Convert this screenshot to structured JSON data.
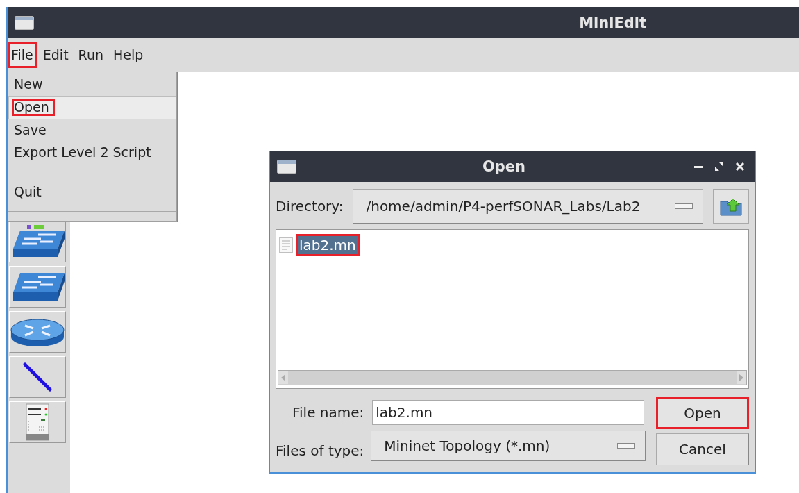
{
  "window": {
    "title": "MiniEdit"
  },
  "menubar": [
    {
      "label": "File",
      "selected": true,
      "highlighted": true
    },
    {
      "label": "Edit",
      "selected": false,
      "highlighted": false
    },
    {
      "label": "Run",
      "selected": false,
      "highlighted": false
    },
    {
      "label": "Help",
      "selected": false,
      "highlighted": false
    }
  ],
  "file_menu": [
    {
      "kind": "item",
      "label": "New",
      "selected": false,
      "highlighted": false
    },
    {
      "kind": "item",
      "label": "Open",
      "selected": true,
      "highlighted": true
    },
    {
      "kind": "item",
      "label": "Save",
      "selected": false,
      "highlighted": false
    },
    {
      "kind": "item",
      "label": "Export Level 2 Script",
      "selected": false,
      "highlighted": false
    },
    {
      "kind": "separator"
    },
    {
      "kind": "item",
      "label": "Quit",
      "selected": false,
      "highlighted": false
    },
    {
      "kind": "separator"
    }
  ],
  "toolbar": [
    {
      "kind": "switch"
    },
    {
      "kind": "legacy-switch"
    },
    {
      "kind": "router"
    },
    {
      "kind": "link"
    },
    {
      "kind": "controller"
    }
  ],
  "dialog": {
    "title": "Open",
    "directory_label": "Directory:",
    "directory": "/home/admin/P4-perfSONAR_Labs/Lab2",
    "files": [
      {
        "name": "lab2.mn",
        "selected": true,
        "highlighted": true
      }
    ],
    "file_name_label": "File name:",
    "file_name": "lab2.mn",
    "file_type_label": "Files of type:",
    "file_type": "Mininet Topology (*.mn)",
    "buttons": [
      {
        "label": "Open",
        "highlighted": true
      },
      {
        "label": "Cancel",
        "highlighted": false
      }
    ]
  }
}
